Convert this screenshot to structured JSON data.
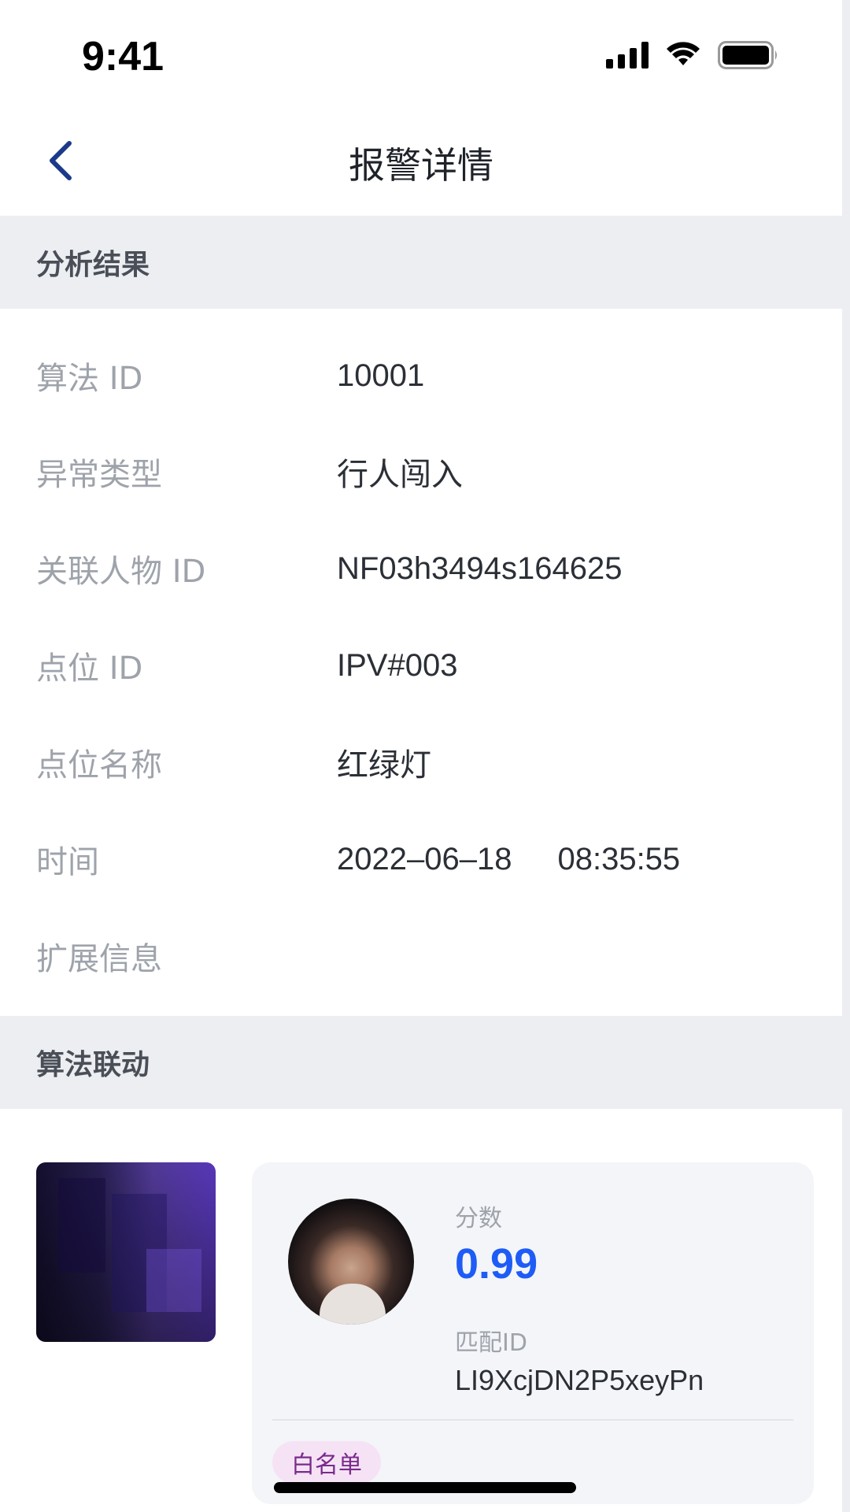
{
  "status_bar": {
    "time": "9:41"
  },
  "nav": {
    "title": "报警详情"
  },
  "sections": {
    "analysis_title": "分析结果",
    "linkage_title": "算法联动"
  },
  "details": [
    {
      "label": "算法 ID",
      "value": "10001"
    },
    {
      "label": "异常类型",
      "value": "行人闯入"
    },
    {
      "label": "关联人物 ID",
      "value": "NF03h3494s164625"
    },
    {
      "label": "点位 ID",
      "value": "IPV#003"
    },
    {
      "label": "点位名称",
      "value": "红绿灯"
    },
    {
      "label": "时间",
      "date": "2022–06–18",
      "time": "08:35:55"
    },
    {
      "label": "扩展信息",
      "value": ""
    }
  ],
  "match": {
    "score_label": "分数",
    "score": "0.99",
    "id_label": "匹配ID",
    "id": "LI9XcjDN2P5xeyPn",
    "tag": "白名单"
  },
  "colors": {
    "accent": "#1e5cf6",
    "section_bg": "#eceef2",
    "tag_bg": "#f5e3f5",
    "tag_text": "#7a2a8c"
  },
  "icons": {
    "back": "chevron-left-icon",
    "signal": "cellular-signal-icon",
    "wifi": "wifi-icon",
    "battery": "battery-icon"
  }
}
